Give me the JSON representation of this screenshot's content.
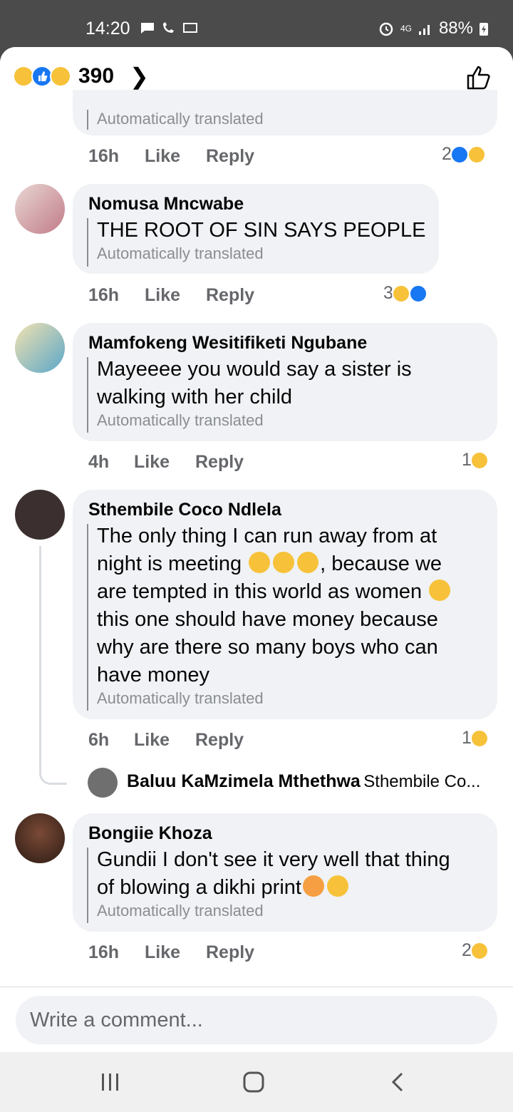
{
  "status": {
    "time": "14:20",
    "network": "4G",
    "battery": "88%"
  },
  "header": {
    "reaction_count": "390"
  },
  "comments": [
    {
      "translated": "Automatically translated",
      "time": "16h",
      "like": "Like",
      "reply": "Reply",
      "react_count": "2"
    },
    {
      "name": "Nomusa Mncwabe",
      "text": "THE ROOT OF SIN SAYS PEOPLE",
      "translated": "Automatically translated",
      "time": "16h",
      "like": "Like",
      "reply": "Reply",
      "react_count": "3"
    },
    {
      "name": "Mamfokeng Wesitifiketi Ngubane",
      "text_line1": "Mayeeee you would say a sister is",
      "text_line2": "walking with her child",
      "translated": "Automatically translated",
      "time": "4h",
      "like": "Like",
      "reply": "Reply",
      "react_count": "1"
    },
    {
      "name": "Sthembile Coco Ndlela",
      "text_line1": "The only thing I can run away from at",
      "text_line2a": "night is meeting ",
      "text_line2b": ", because we",
      "text_line3": "are tempted in this world as women ",
      "text_line4": "this one should have money because",
      "text_line5": "why are there so many boys who can",
      "text_line6": "have money",
      "translated": "Automatically translated",
      "time": "6h",
      "like": "Like",
      "reply": "Reply",
      "react_count": "1"
    },
    {
      "name": "Bongiie Khoza",
      "text_line1": "Gundii I don't see it very well that thing",
      "text_line2": "of blowing a dikhi print",
      "translated": "Automatically translated",
      "time": "16h",
      "like": "Like",
      "reply": "Reply",
      "react_count": "2"
    }
  ],
  "reply_preview": {
    "name": "Baluu KaMzimela Mthethwa",
    "snippet": "Sthembile Co..."
  },
  "composer": {
    "placeholder": "Write a comment..."
  },
  "colors": {
    "like_blue": "#1877f2",
    "haha_yellow": "#f7c23a",
    "bubble": "#f0f2f5",
    "meta_gray": "#65676b"
  }
}
